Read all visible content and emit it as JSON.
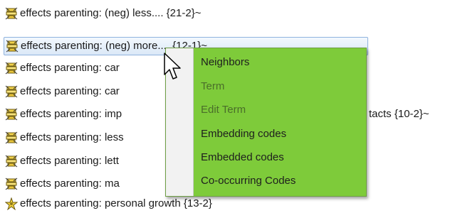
{
  "code_list": {
    "items": [
      {
        "text": "effects parenting: (neg) less.... {21-2}~",
        "icon": "code-family-icon",
        "selected": false
      },
      {
        "text": "effects parenting: (neg) more.... {12-1}~",
        "icon": "code-family-icon",
        "selected": true
      },
      {
        "text": "effects parenting: car",
        "icon": "code-family-icon",
        "selected": false
      },
      {
        "text": "effects parenting: car",
        "icon": "code-family-icon",
        "selected": false
      },
      {
        "text": "effects parenting: imp",
        "icon": "code-family-icon",
        "selected": false
      },
      {
        "text": "effects parenting: less",
        "icon": "code-family-icon",
        "selected": false
      },
      {
        "text": "effects parenting: lett",
        "icon": "code-family-icon",
        "selected": false
      },
      {
        "text": "effects parenting: ma",
        "icon": "code-family-icon",
        "selected": false
      },
      {
        "text": "effects parenting: personal growth {13-2}",
        "icon": "code-star-icon",
        "selected": false
      }
    ],
    "obscured_suffix": "tacts {10-2}~"
  },
  "context_menu": {
    "items": [
      {
        "label": "Neighbors",
        "enabled": true
      },
      {
        "label": "Term",
        "enabled": false
      },
      {
        "label": "Edit Term",
        "enabled": false
      },
      {
        "label": "Embedding codes",
        "enabled": true
      },
      {
        "label": "Embedded codes",
        "enabled": true
      },
      {
        "label": "Co-occurring Codes",
        "enabled": true
      }
    ]
  },
  "colors": {
    "menu_background": "#7ecb3a",
    "menu_gutter": "#f2f2f2",
    "selection_border": "#8fb2de",
    "selection_fill": "#dbe8f7",
    "disabled_text": "#4a6e2a"
  },
  "cursor": {
    "icon": "arrow-cursor-icon"
  }
}
